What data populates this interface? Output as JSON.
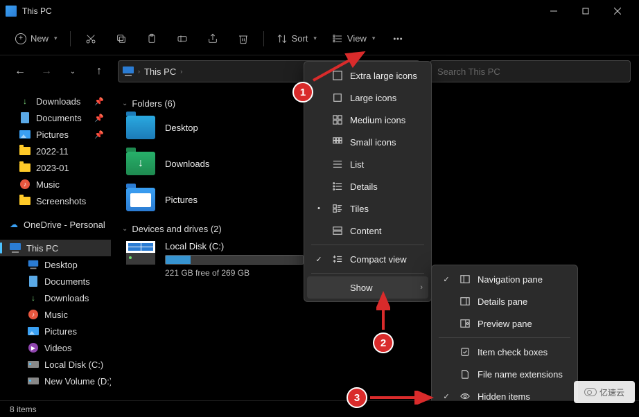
{
  "titlebar": {
    "title": "This PC"
  },
  "toolbar": {
    "new_label": "New",
    "sort_label": "Sort",
    "view_label": "View"
  },
  "address": {
    "crumb": "This PC",
    "search_placeholder": "Search This PC"
  },
  "sidebar": {
    "quick": [
      {
        "label": "Downloads",
        "icon": "download",
        "pinned": true
      },
      {
        "label": "Documents",
        "icon": "document",
        "pinned": true
      },
      {
        "label": "Pictures",
        "icon": "picture",
        "pinned": true
      },
      {
        "label": "2022-11",
        "icon": "folder",
        "pinned": false
      },
      {
        "label": "2023-01",
        "icon": "folder",
        "pinned": false
      },
      {
        "label": "Music",
        "icon": "music",
        "pinned": false
      },
      {
        "label": "Screenshots",
        "icon": "folder",
        "pinned": false
      }
    ],
    "onedrive": {
      "label": "OneDrive - Personal"
    },
    "thispc": {
      "label": "This PC",
      "children": [
        {
          "label": "Desktop",
          "icon": "desktop"
        },
        {
          "label": "Documents",
          "icon": "document"
        },
        {
          "label": "Downloads",
          "icon": "download"
        },
        {
          "label": "Music",
          "icon": "music"
        },
        {
          "label": "Pictures",
          "icon": "picture"
        },
        {
          "label": "Videos",
          "icon": "video"
        },
        {
          "label": "Local Disk (C:)",
          "icon": "drive"
        },
        {
          "label": "New Volume (D:)",
          "icon": "drive"
        }
      ]
    }
  },
  "content": {
    "folders_header": "Folders (6)",
    "folders": [
      {
        "label": "Desktop",
        "variant": "blue"
      },
      {
        "label": "Downloads",
        "variant": "green"
      },
      {
        "label": "Pictures",
        "variant": "pic"
      }
    ],
    "drives_header": "Devices and drives (2)",
    "drive": {
      "name": "Local Disk (C:)",
      "free_text": "221 GB free of 269 GB",
      "fill_pct": 18
    }
  },
  "view_menu": {
    "items": [
      {
        "label": "Extra large icons",
        "checked": false
      },
      {
        "label": "Large icons",
        "checked": false
      },
      {
        "label": "Medium icons",
        "checked": false
      },
      {
        "label": "Small icons",
        "checked": false
      },
      {
        "label": "List",
        "checked": false
      },
      {
        "label": "Details",
        "checked": false
      },
      {
        "label": "Tiles",
        "checked": true
      },
      {
        "label": "Content",
        "checked": false
      }
    ],
    "compact": {
      "label": "Compact view",
      "checked": true
    },
    "show": {
      "label": "Show"
    }
  },
  "show_menu": {
    "items": [
      {
        "label": "Navigation pane",
        "checked": true
      },
      {
        "label": "Details pane",
        "checked": false
      },
      {
        "label": "Preview pane",
        "checked": false
      },
      {
        "label": "Item check boxes",
        "checked": false
      },
      {
        "label": "File name extensions",
        "checked": false
      },
      {
        "label": "Hidden items",
        "checked": true
      }
    ]
  },
  "status": {
    "text": "8 items"
  },
  "annotations": {
    "1": "1",
    "2": "2",
    "3": "3"
  },
  "watermark": "亿速云"
}
